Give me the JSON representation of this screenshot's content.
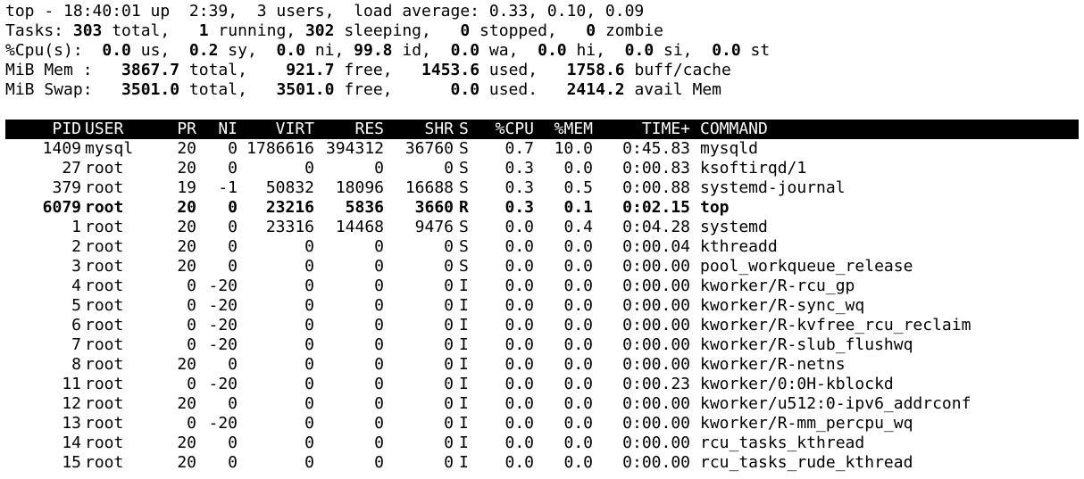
{
  "summary": {
    "line1": "top - 18:40:01 up  2:39,  3 users,  load average: 0.33, 0.10, 0.09",
    "tasks": {
      "label": "Tasks: ",
      "total": "303",
      "total_label": " total,   ",
      "running": "1",
      "running_label": " running, ",
      "sleeping": "302",
      "sleeping_label": " sleeping,   ",
      "stopped": "0",
      "stopped_label": " stopped,   ",
      "zombie": "0",
      "zombie_label": " zombie"
    },
    "cpu": {
      "label": "%Cpu(s):  ",
      "us": "0.0",
      "us_label": " us,  ",
      "sy": "0.2",
      "sy_label": " sy,  ",
      "ni": "0.0",
      "ni_label": " ni, ",
      "id": "99.8",
      "id_label": " id,  ",
      "wa": "0.0",
      "wa_label": " wa,  ",
      "hi": "0.0",
      "hi_label": " hi,  ",
      "si": "0.0",
      "si_label": " si,  ",
      "st": "0.0",
      "st_label": " st"
    },
    "mem": {
      "label": "MiB Mem :   ",
      "total": "3867.7",
      "total_label": " total,    ",
      "free": "921.7",
      "free_label": " free,   ",
      "used": "1453.6",
      "used_label": " used,   ",
      "buff": "1758.6",
      "buff_label": " buff/cache"
    },
    "swap": {
      "label": "MiB Swap:   ",
      "total": "3501.0",
      "total_label": " total,   ",
      "free": "3501.0",
      "free_label": " free,      ",
      "used": "0.0",
      "used_label": " used.   ",
      "avail": "2414.2",
      "avail_label": " avail Mem"
    }
  },
  "columns": {
    "pid": "PID",
    "user": "USER",
    "pr": "PR",
    "ni": "NI",
    "virt": "VIRT",
    "res": "RES",
    "shr": "SHR",
    "s": "S",
    "cpu": "%CPU",
    "mem": "%MEM",
    "time": "TIME+",
    "command": "COMMAND"
  },
  "processes": [
    {
      "pid": "1409",
      "user": "mysql",
      "pr": "20",
      "ni": "0",
      "virt": "1786616",
      "res": "394312",
      "shr": "36760",
      "s": "S",
      "cpu": "0.7",
      "mem": "10.0",
      "time": "0:45.83",
      "command": "mysqld"
    },
    {
      "pid": "27",
      "user": "root",
      "pr": "20",
      "ni": "0",
      "virt": "0",
      "res": "0",
      "shr": "0",
      "s": "S",
      "cpu": "0.3",
      "mem": "0.0",
      "time": "0:00.83",
      "command": "ksoftirqd/1"
    },
    {
      "pid": "379",
      "user": "root",
      "pr": "19",
      "ni": "-1",
      "virt": "50832",
      "res": "18096",
      "shr": "16688",
      "s": "S",
      "cpu": "0.3",
      "mem": "0.5",
      "time": "0:00.88",
      "command": "systemd-journal"
    },
    {
      "pid": "6079",
      "user": "root",
      "pr": "20",
      "ni": "0",
      "virt": "23216",
      "res": "5836",
      "shr": "3660",
      "s": "R",
      "cpu": "0.3",
      "mem": "0.1",
      "time": "0:02.15",
      "command": "top"
    },
    {
      "pid": "1",
      "user": "root",
      "pr": "20",
      "ni": "0",
      "virt": "23316",
      "res": "14468",
      "shr": "9476",
      "s": "S",
      "cpu": "0.0",
      "mem": "0.4",
      "time": "0:04.28",
      "command": "systemd"
    },
    {
      "pid": "2",
      "user": "root",
      "pr": "20",
      "ni": "0",
      "virt": "0",
      "res": "0",
      "shr": "0",
      "s": "S",
      "cpu": "0.0",
      "mem": "0.0",
      "time": "0:00.04",
      "command": "kthreadd"
    },
    {
      "pid": "3",
      "user": "root",
      "pr": "20",
      "ni": "0",
      "virt": "0",
      "res": "0",
      "shr": "0",
      "s": "S",
      "cpu": "0.0",
      "mem": "0.0",
      "time": "0:00.00",
      "command": "pool_workqueue_release"
    },
    {
      "pid": "4",
      "user": "root",
      "pr": "0",
      "ni": "-20",
      "virt": "0",
      "res": "0",
      "shr": "0",
      "s": "I",
      "cpu": "0.0",
      "mem": "0.0",
      "time": "0:00.00",
      "command": "kworker/R-rcu_gp"
    },
    {
      "pid": "5",
      "user": "root",
      "pr": "0",
      "ni": "-20",
      "virt": "0",
      "res": "0",
      "shr": "0",
      "s": "I",
      "cpu": "0.0",
      "mem": "0.0",
      "time": "0:00.00",
      "command": "kworker/R-sync_wq"
    },
    {
      "pid": "6",
      "user": "root",
      "pr": "0",
      "ni": "-20",
      "virt": "0",
      "res": "0",
      "shr": "0",
      "s": "I",
      "cpu": "0.0",
      "mem": "0.0",
      "time": "0:00.00",
      "command": "kworker/R-kvfree_rcu_reclaim"
    },
    {
      "pid": "7",
      "user": "root",
      "pr": "0",
      "ni": "-20",
      "virt": "0",
      "res": "0",
      "shr": "0",
      "s": "I",
      "cpu": "0.0",
      "mem": "0.0",
      "time": "0:00.00",
      "command": "kworker/R-slub_flushwq"
    },
    {
      "pid": "8",
      "user": "root",
      "pr": "20",
      "ni": "0",
      "virt": "0",
      "res": "0",
      "shr": "0",
      "s": "I",
      "cpu": "0.0",
      "mem": "0.0",
      "time": "0:00.00",
      "command": "kworker/R-netns"
    },
    {
      "pid": "11",
      "user": "root",
      "pr": "0",
      "ni": "-20",
      "virt": "0",
      "res": "0",
      "shr": "0",
      "s": "I",
      "cpu": "0.0",
      "mem": "0.0",
      "time": "0:00.23",
      "command": "kworker/0:0H-kblockd"
    },
    {
      "pid": "12",
      "user": "root",
      "pr": "20",
      "ni": "0",
      "virt": "0",
      "res": "0",
      "shr": "0",
      "s": "I",
      "cpu": "0.0",
      "mem": "0.0",
      "time": "0:00.00",
      "command": "kworker/u512:0-ipv6_addrconf"
    },
    {
      "pid": "13",
      "user": "root",
      "pr": "0",
      "ni": "-20",
      "virt": "0",
      "res": "0",
      "shr": "0",
      "s": "I",
      "cpu": "0.0",
      "mem": "0.0",
      "time": "0:00.00",
      "command": "kworker/R-mm_percpu_wq"
    },
    {
      "pid": "14",
      "user": "root",
      "pr": "20",
      "ni": "0",
      "virt": "0",
      "res": "0",
      "shr": "0",
      "s": "I",
      "cpu": "0.0",
      "mem": "0.0",
      "time": "0:00.00",
      "command": "rcu_tasks_kthread"
    },
    {
      "pid": "15",
      "user": "root",
      "pr": "20",
      "ni": "0",
      "virt": "0",
      "res": "0",
      "shr": "0",
      "s": "I",
      "cpu": "0.0",
      "mem": "0.0",
      "time": "0:00.00",
      "command": "rcu_tasks_rude_kthread"
    }
  ],
  "highlight_pid": "6079",
  "colors": {
    "background": "#ffffff",
    "foreground": "#000000",
    "header_bg": "#000000",
    "header_fg": "#ffffff"
  }
}
